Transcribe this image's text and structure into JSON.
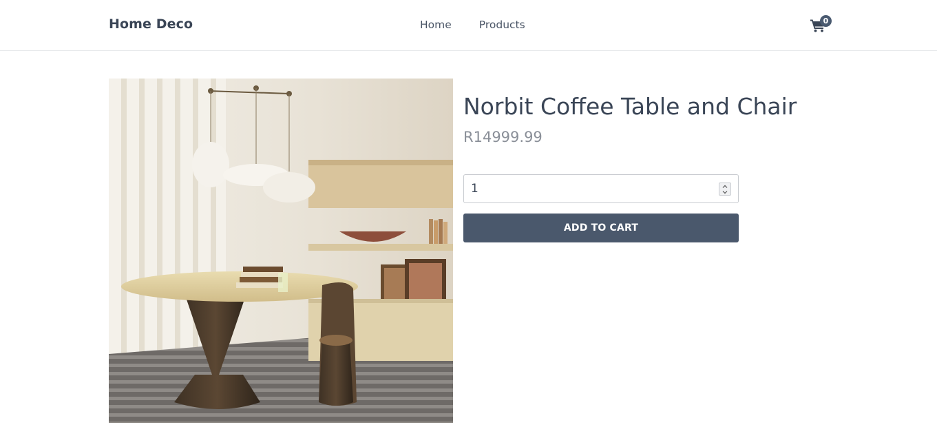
{
  "header": {
    "brand": "Home Deco",
    "nav": [
      "Home",
      "Products"
    ],
    "cart_count": "0"
  },
  "product": {
    "title": "Norbit Coffee Table and Chair",
    "price": "R14999.99",
    "quantity": "1",
    "add_to_cart_label": "ADD TO CART",
    "image_icon": "product-photo"
  },
  "colors": {
    "accent": "#4a586c",
    "text": "#3a4556",
    "price": "#8a8f98"
  }
}
